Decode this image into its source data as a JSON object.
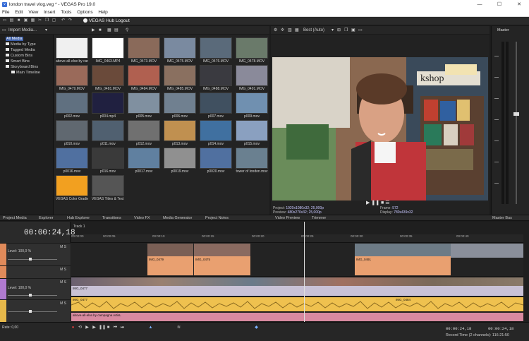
{
  "window": {
    "title": "london travel vlog.veg * - VEGAS Pro 19.0",
    "buttons": [
      "—",
      "☐",
      "✕"
    ]
  },
  "menu": [
    "File",
    "Edit",
    "View",
    "Insert",
    "Tools",
    "Options",
    "Help"
  ],
  "toolbar": {
    "hub_label": "VEGAS Hub Logout"
  },
  "media": {
    "import_label": "Import Media...",
    "tree": [
      {
        "label": "All Media",
        "selected": true
      },
      {
        "label": "Media by Type"
      },
      {
        "label": "Tagged Media"
      },
      {
        "label": "Custom Bins"
      },
      {
        "label": "Smart Bins"
      },
      {
        "label": "Storyboard Bins"
      },
      {
        "label": "Main Timeline"
      }
    ],
    "items": [
      {
        "name": "above-all-else by campagna ArtistLoop",
        "color": "#f0f0f0"
      },
      {
        "name": "IMG_0463.MP4",
        "color": "#ffffff"
      },
      {
        "name": "IMG_0473.MOV",
        "color": "#8a6a5a"
      },
      {
        "name": "IMG_0475.MOV",
        "color": "#7a8aa0"
      },
      {
        "name": "IMG_0476.MOV",
        "color": "#5a6a7a"
      },
      {
        "name": "IMG_0478.MOV",
        "color": "#6a7a6a"
      },
      {
        "name": "IMG_0479.MOV",
        "color": "#9a6a5a"
      },
      {
        "name": "IMG_0481.MOV",
        "color": "#6a4a3a"
      },
      {
        "name": "IMG_0484.MOV",
        "color": "#b06050"
      },
      {
        "name": "IMG_0485.MOV",
        "color": "#8a7060"
      },
      {
        "name": "IMG_0488.MOV",
        "color": "#3a3a40"
      },
      {
        "name": "IMG_0491.MOV",
        "color": "#8a8a9a"
      },
      {
        "name": "p002.mov",
        "color": "#607080"
      },
      {
        "name": "p004.mp4",
        "color": "#202040"
      },
      {
        "name": "p005.mov",
        "color": "#8090a0"
      },
      {
        "name": "p006.mov",
        "color": "#708090"
      },
      {
        "name": "p007.mov",
        "color": "#405060"
      },
      {
        "name": "p009.mov",
        "color": "#7090b0"
      },
      {
        "name": "p010.mov",
        "color": "#606870"
      },
      {
        "name": "p011.mov",
        "color": "#506070"
      },
      {
        "name": "p012.mov",
        "color": "#707070"
      },
      {
        "name": "p013.mov",
        "color": "#c09050"
      },
      {
        "name": "p014.mov",
        "color": "#4070a0"
      },
      {
        "name": "p015.mov",
        "color": "#8aa0c0"
      },
      {
        "name": "p0016.mov",
        "color": "#5070a0"
      },
      {
        "name": "p016.mov",
        "color": "#3a3a3a"
      },
      {
        "name": "p0017.mov",
        "color": "#6080a0"
      },
      {
        "name": "p0019.mov",
        "color": "#909090"
      },
      {
        "name": "p0020.mov",
        "color": "#5070a0"
      },
      {
        "name": "tower of london.mov",
        "color": "#6a8090"
      },
      {
        "name": "VEGAS Color Gradient 22",
        "color": "#f2a020"
      },
      {
        "name": "VEGAS Titles & Text 21",
        "color": "#555555"
      }
    ]
  },
  "panel_tabs": [
    "Project Media",
    "Explorer",
    "Hub Explorer",
    "Transitions",
    "Video FX",
    "Media Generator",
    "Project Notes",
    "Video Preview",
    "Trimmer",
    "Master Bus"
  ],
  "preview": {
    "quality": "Best (Auto)",
    "project_label": "Project:",
    "project_value": "1920x1080x32; 25,000p",
    "preview_label": "Preview:",
    "preview_value": "480x270x32; 25,000p",
    "frame_label": "Frame:",
    "frame_value": "572",
    "display_label": "Display:",
    "display_value": "780x439x32"
  },
  "master": {
    "label": "Master"
  },
  "timeline": {
    "timecode": "00:00:24,18",
    "track_label": "Track 1",
    "level_label_1": "Level: 100,0 %",
    "level_label_2": "Level: 100,0 %",
    "rate_label": "Rate: 0,00",
    "ruler_ticks": [
      "00:00:00",
      "00:00:05",
      "00:00:10",
      "00:00:15",
      "00:00:20",
      "00:00:25",
      "00:00:30",
      "00:00:35",
      "00:00:40"
    ],
    "clips": {
      "c1": "IMG_0479",
      "c2": "IMG_0475",
      "c3": "IMG_0491",
      "c4": "IMG_0477",
      "c5": "IMG_0484",
      "music": "above-all-else by campagna ArtisL"
    },
    "bottom_timecode": "00:00:24,18",
    "end_timecode": "00:00:24,18",
    "record_time": "Record Time (2 channels): 116:21:50"
  },
  "colors": {
    "accent": "#3d5fa8",
    "video_clip": "#e9a070",
    "audio_clip": "#efc14f"
  }
}
